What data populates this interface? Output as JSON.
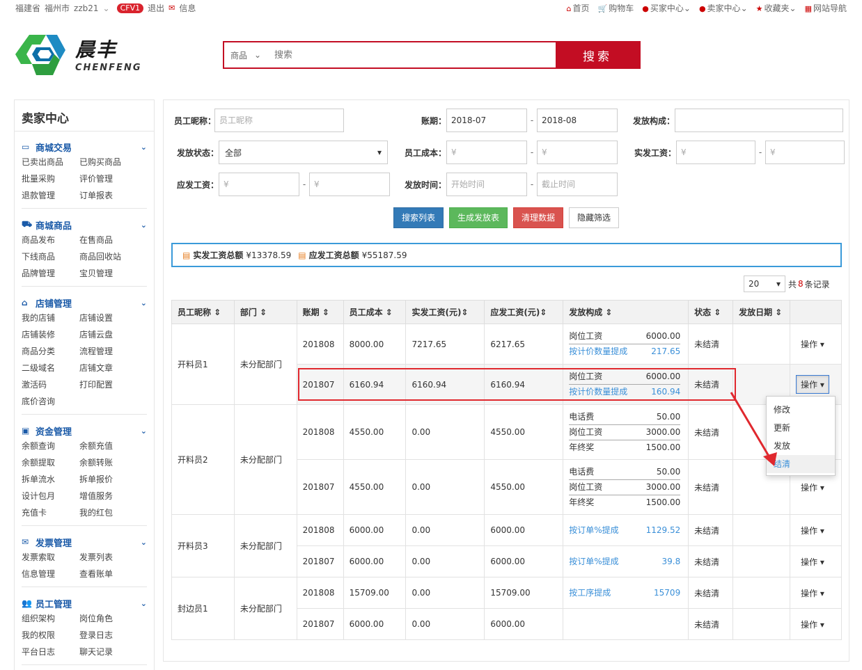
{
  "topbar": {
    "province": "福建省",
    "city": "福州市",
    "username": "zzb21",
    "level": "CFV1",
    "logout": "退出",
    "message": "信息",
    "links": [
      {
        "icon": "home-icon",
        "label": "首页"
      },
      {
        "icon": "cart-icon",
        "label": "购物车"
      },
      {
        "icon": "user-icon",
        "label": "买家中心"
      },
      {
        "icon": "user-icon",
        "label": "卖家中心"
      },
      {
        "icon": "star-icon",
        "label": "收藏夹"
      },
      {
        "icon": "grid-icon",
        "label": "网站导航"
      }
    ]
  },
  "logo": {
    "cn": "晨丰",
    "en": "CHENFENG"
  },
  "search": {
    "type": "商品",
    "placeholder": "搜索",
    "button": "搜索"
  },
  "sidebar": {
    "title": "卖家中心",
    "groups": [
      {
        "title": "商城交易",
        "icon": "card-icon",
        "items": [
          "已卖出商品",
          "已购买商品",
          "批量采购",
          "评价管理",
          "退款管理",
          "订单报表"
        ]
      },
      {
        "title": "商城商品",
        "icon": "truck-icon",
        "items": [
          "商品发布",
          "在售商品",
          "下线商品",
          "商品回收站",
          "品牌管理",
          "宝贝管理"
        ]
      },
      {
        "title": "店铺管理",
        "icon": "home-icon",
        "items": [
          "我的店铺",
          "店铺设置",
          "店铺装修",
          "店铺云盘",
          "商品分类",
          "流程管理",
          "二级域名",
          "店铺文章",
          "激活码",
          "打印配置",
          "底价咨询"
        ]
      },
      {
        "title": "资金管理",
        "icon": "money-icon",
        "items": [
          "余额查询",
          "余额充值",
          "余额提取",
          "余额转账",
          "拆单流水",
          "拆单报价",
          "设计包月",
          "增值服务",
          "充值卡",
          "我的红包"
        ]
      },
      {
        "title": "发票管理",
        "icon": "envelope-icon",
        "items": [
          "发票索取",
          "发票列表",
          "信息管理",
          "查看账单"
        ]
      },
      {
        "title": "员工管理",
        "icon": "users-icon",
        "items": [
          "组织架构",
          "岗位角色",
          "我的权限",
          "登录日志",
          "平台日志",
          "聊天记录"
        ]
      }
    ]
  },
  "filters": {
    "nickname_label": "员工昵称：",
    "nickname_placeholder": "员工昵称",
    "period_label": "账期：",
    "period_from": "2018-07",
    "period_to": "2018-08",
    "composition_label": "发放构成：",
    "status_label": "发放状态：",
    "status_value": "全部",
    "cost_label": "员工成本：",
    "actual_label": "实发工资：",
    "payable_label": "应发工资：",
    "yen": "¥",
    "time_label": "发放时间：",
    "time_from": "开始时间",
    "time_to": "截止时间",
    "dash": "-"
  },
  "buttons": {
    "search": "搜索列表",
    "generate": "生成发放表",
    "clear": "清理数据",
    "hide": "隐藏筛选"
  },
  "summary": {
    "actual_label": "实发工资总额",
    "actual_value": "¥13378.59",
    "payable_label": "应发工资总额",
    "payable_value": "¥55187.59"
  },
  "pager": {
    "size": "20",
    "prefix": "共",
    "count": "8",
    "suffix": "条记录"
  },
  "table": {
    "headers": [
      "员工昵称",
      "部门",
      "账期",
      "员工成本",
      "实发工资(元)",
      "应发工资(元)",
      "发放构成",
      "状态",
      "发放日期",
      ""
    ],
    "sort": "⇕",
    "op_label": "操作",
    "groups": [
      {
        "name": "开料员1",
        "dept": "未分配部门",
        "rows": [
          {
            "period": "201808",
            "cost": "8000.00",
            "actual": "7217.65",
            "payable": "6217.65",
            "status": "未结清",
            "items": [
              {
                "k": "岗位工资",
                "v": "6000.00",
                "blue": false
              },
              {
                "k": "按计价数量提成",
                "v": "217.65",
                "blue": true
              }
            ]
          },
          {
            "period": "201807",
            "cost": "6160.94",
            "actual": "6160.94",
            "payable": "6160.94",
            "status": "未结清",
            "items": [
              {
                "k": "岗位工资",
                "v": "6000.00",
                "blue": false
              },
              {
                "k": "按计价数量提成",
                "v": "160.94",
                "blue": true
              }
            ]
          }
        ]
      },
      {
        "name": "开料员2",
        "dept": "未分配部门",
        "rows": [
          {
            "period": "201808",
            "cost": "4550.00",
            "actual": "0.00",
            "payable": "4550.00",
            "status": "未结清",
            "items": [
              {
                "k": "电话费",
                "v": "50.00",
                "blue": false
              },
              {
                "k": "岗位工资",
                "v": "3000.00",
                "blue": false
              },
              {
                "k": "年终奖",
                "v": "1500.00",
                "blue": false
              }
            ]
          },
          {
            "period": "201807",
            "cost": "4550.00",
            "actual": "0.00",
            "payable": "4550.00",
            "status": "未结清",
            "items": [
              {
                "k": "电话费",
                "v": "50.00",
                "blue": false
              },
              {
                "k": "岗位工资",
                "v": "3000.00",
                "blue": false
              },
              {
                "k": "年终奖",
                "v": "1500.00",
                "blue": false
              }
            ]
          }
        ]
      },
      {
        "name": "开料员3",
        "dept": "未分配部门",
        "rows": [
          {
            "period": "201808",
            "cost": "6000.00",
            "actual": "0.00",
            "payable": "6000.00",
            "status": "未结清",
            "items": [
              {
                "k": "按订单%提成",
                "v": "1129.52",
                "blue": true
              }
            ]
          },
          {
            "period": "201807",
            "cost": "6000.00",
            "actual": "0.00",
            "payable": "6000.00",
            "status": "未结清",
            "items": [
              {
                "k": "按订单%提成",
                "v": "39.8",
                "blue": true
              }
            ]
          }
        ]
      },
      {
        "name": "封边员1",
        "dept": "未分配部门",
        "rows": [
          {
            "period": "201808",
            "cost": "15709.00",
            "actual": "0.00",
            "payable": "15709.00",
            "status": "未结清",
            "items": [
              {
                "k": "按工序提成",
                "v": "15709",
                "blue": true
              }
            ]
          },
          {
            "period": "201807",
            "cost": "6000.00",
            "actual": "0.00",
            "payable": "6000.00",
            "status": "未结清",
            "items": []
          }
        ]
      }
    ]
  },
  "dropdown": {
    "items": [
      "修改",
      "更新",
      "发放",
      "结清"
    ]
  },
  "colors": {
    "brand_red": "#c30d23",
    "link_blue": "#1a5aa8",
    "highlight_red": "#e0282e"
  }
}
